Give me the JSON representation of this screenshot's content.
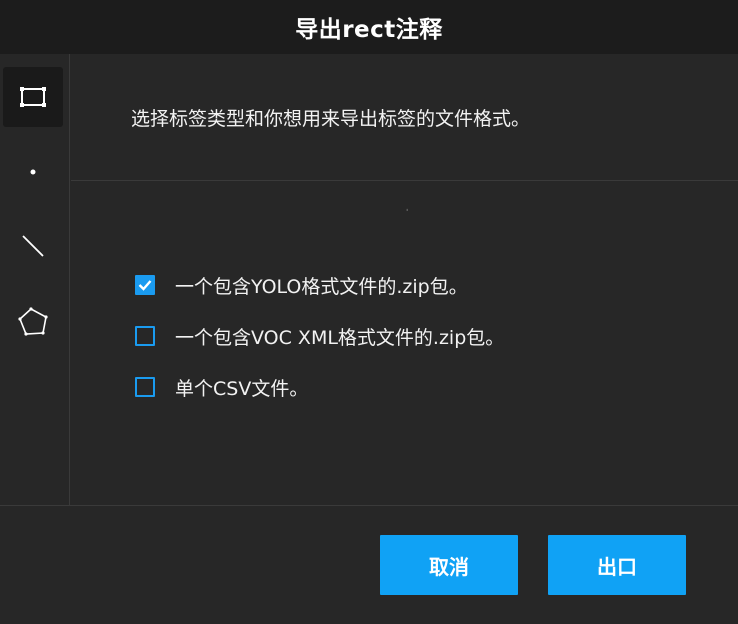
{
  "header": {
    "title": "导出rect注释"
  },
  "sidebar": {
    "tools": [
      {
        "icon": "rectangle-icon",
        "active": true
      },
      {
        "icon": "point-icon",
        "active": false
      },
      {
        "icon": "line-icon",
        "active": false
      },
      {
        "icon": "polygon-icon",
        "active": false
      }
    ]
  },
  "main": {
    "description": "选择标签类型和你想用来导出标签的文件格式。",
    "stray_mark": "ˌ",
    "options": [
      {
        "label": "一个包含YOLO格式文件的.zip包。",
        "checked": true
      },
      {
        "label": "一个包含VOC XML格式文件的.zip包。",
        "checked": false
      },
      {
        "label": "单个CSV文件。",
        "checked": false
      }
    ]
  },
  "footer": {
    "cancel_label": "取消",
    "export_label": "出口"
  },
  "colors": {
    "accent": "#10a2f5",
    "background": "#272727",
    "header": "#1c1c1c"
  }
}
